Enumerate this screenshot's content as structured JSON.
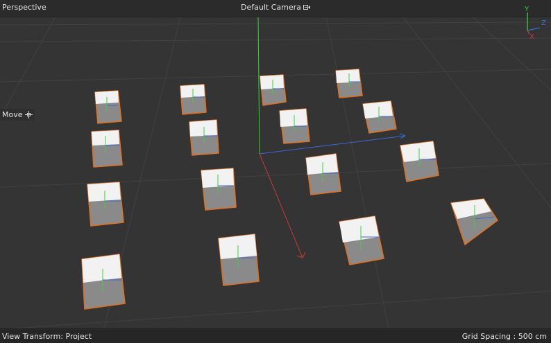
{
  "viewport": {
    "view_mode": "Perspective",
    "camera": "Default Camera",
    "tool": "Move",
    "view_transform": "View Transform: Project",
    "grid_spacing": "Grid Spacing : 500 cm"
  },
  "gizmo": {
    "y": "Y",
    "z": "Z",
    "x": "X"
  },
  "scene": {
    "object_count": 17,
    "selection_color": "#e07020",
    "axis_colors": {
      "x": "#c83a3a",
      "y": "#3ad23a",
      "z": "#3a6ad2"
    }
  },
  "icons": {
    "camera": "camera-link-icon",
    "move": "move-crosshair-icon"
  }
}
